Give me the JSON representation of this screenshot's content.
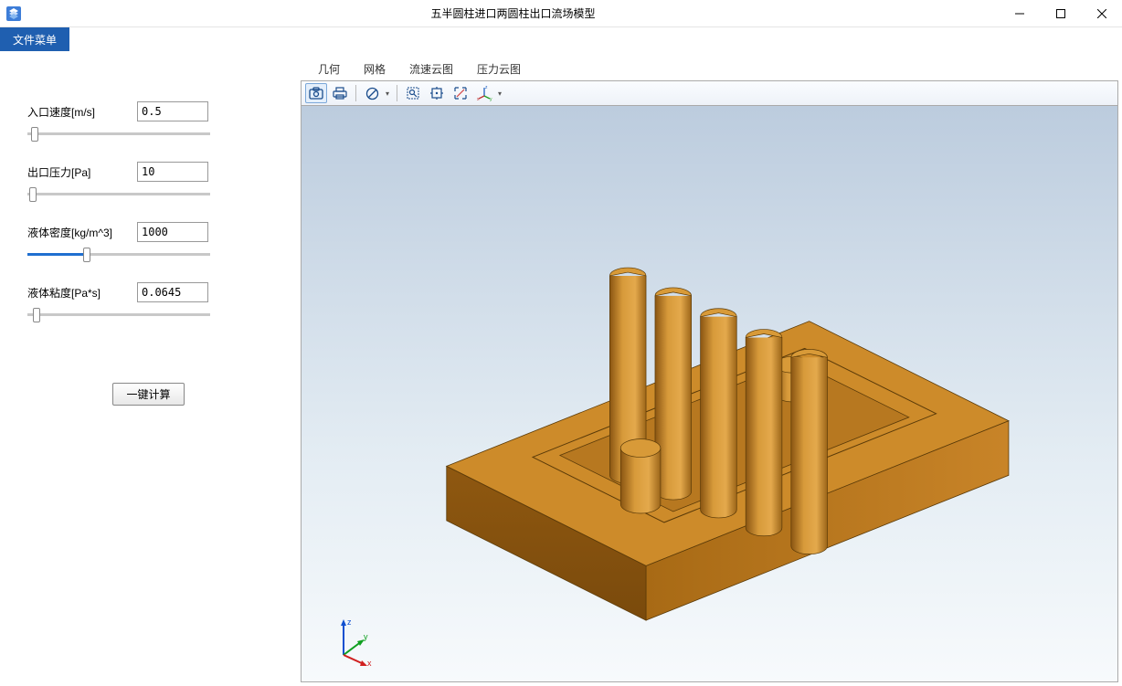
{
  "window": {
    "title": "五半圆柱进口两圆柱出口流场模型"
  },
  "menu": {
    "file": "文件菜单"
  },
  "params": {
    "inlet_velocity": {
      "label": "入口速度[m/s]",
      "value": "0.5",
      "slider_pct": 2
    },
    "outlet_pressure": {
      "label": "出口压力[Pa]",
      "value": "10",
      "slider_pct": 1
    },
    "density": {
      "label": "液体密度[kg/m^3]",
      "value": "1000",
      "slider_pct": 32
    },
    "viscosity": {
      "label": "液体粘度[Pa*s]",
      "value": "0.0645",
      "slider_pct": 3
    }
  },
  "buttons": {
    "calculate": "一键计算"
  },
  "tabs": {
    "geometry": "几何",
    "mesh": "网格",
    "velocity_contour": "流速云图",
    "pressure_contour": "压力云图"
  },
  "toolbar_icons": {
    "screenshot": "camera-icon",
    "print": "print-icon",
    "none": "no-symbol-icon",
    "zoom_window": "zoom-window-icon",
    "reset": "zoom-extents-icon",
    "zoom_sel": "zoom-select-icon",
    "rotate": "rotate-xyz-icon"
  },
  "triad": {
    "x": "x",
    "y": "y",
    "z": "z"
  }
}
